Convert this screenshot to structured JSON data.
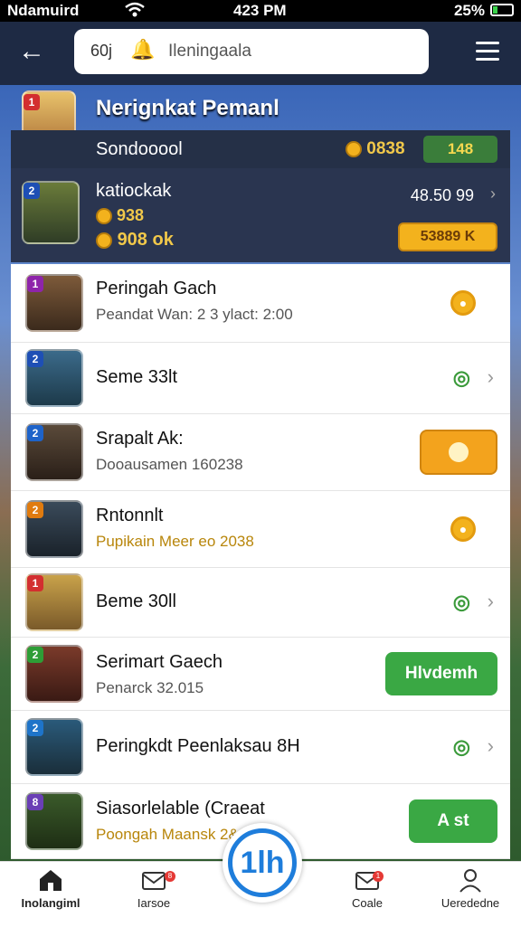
{
  "status": {
    "carrier": "Ndamuird",
    "time": "423 PM",
    "battery": "25%",
    "battery_level": 0.25
  },
  "topbar": {
    "search_prefix": "60j",
    "search_placeholder": "Ileningaala"
  },
  "hero": {
    "title": "Nerignkat Pemanl",
    "user_name": "Sondooool",
    "points_yellow": "0838",
    "points_green": "148",
    "card": {
      "name": "katiockak",
      "line2": "938",
      "line3": "908 ok",
      "score": "48.50 99",
      "gold_btn": "53889 K"
    }
  },
  "list": [
    {
      "rank": "1",
      "badge_color": "#8e24aa",
      "title": "Peringah Gach",
      "subtitle": "Peandat Wan: 2 3 ylact: 2:00",
      "action": "coin"
    },
    {
      "rank": "2",
      "badge_color": "#1e4fb5",
      "title": "Seme 33lt",
      "subtitle": "",
      "action": "chevron"
    },
    {
      "rank": "2",
      "badge_color": "#1e63c9",
      "title": "Srapalt Ak:",
      "subtitle": "Dooausamen 160238",
      "action": "orange-button"
    },
    {
      "rank": "2",
      "badge_color": "#e07b0f",
      "title": "Rntonnlt",
      "subtitle": "Pupikain Meer eo 2038",
      "action": "coin",
      "subtitle_gold": true
    },
    {
      "rank": "1",
      "badge_color": "#d32f2f",
      "title": "Beme 30ll",
      "subtitle": "",
      "action": "chevron"
    },
    {
      "rank": "2",
      "badge_color": "#2e9d36",
      "title": "Serimart Gaech",
      "subtitle": "Penarck 32.015",
      "action": "green-button",
      "button_label": "Hlvdemh"
    },
    {
      "rank": "2",
      "badge_color": "#1e74c9",
      "title": "Peringkdt Peenlaksau 8H",
      "subtitle": "",
      "action": "chevron"
    },
    {
      "rank": "8",
      "badge_color": "#6a3fb5",
      "title": "Siasorlelable (Craeat",
      "subtitle": "Poongah Maansk 2&8",
      "action": "green-button",
      "button_label": "A st",
      "subtitle_gold": true
    }
  ],
  "tabs": [
    {
      "label": "Inolangiml",
      "icon": "home-icon"
    },
    {
      "label": "Iarsoe",
      "icon": "mail-shield-icon",
      "badge": "8"
    },
    {
      "label": "Coale",
      "icon": "envelope-icon",
      "badge": "1"
    },
    {
      "label": "Uerededne",
      "icon": "user-icon"
    }
  ],
  "fab": {
    "label": "1lh"
  },
  "colors": {
    "accent_blue": "#1e7ddb",
    "green": "#3aa844",
    "orange": "#f3a31d"
  }
}
